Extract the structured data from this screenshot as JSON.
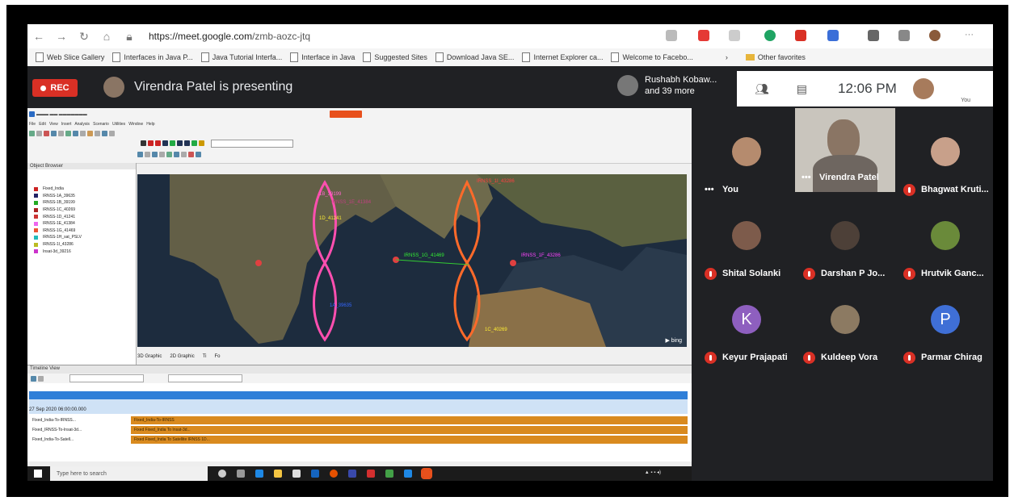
{
  "browser": {
    "url_host": "https://meet.google.com",
    "url_path": "/zmb-aozc-jtq",
    "favorites": [
      "Web Slice Gallery",
      "Interfaces in Java P...",
      "Java Tutorial Interfa...",
      "Interface in Java",
      "Suggested Sites",
      "Download Java SE...",
      "Internet Explorer ca...",
      "Welcome to Facebo..."
    ],
    "other_favorites": "Other favorites"
  },
  "meet": {
    "rec_label": "REC",
    "presenting_text": "Virendra Patel is presenting",
    "participants_name": "Rushabh Kobaw...",
    "participants_more": "and 39 more",
    "clock": "12:06 PM",
    "self_label": "You"
  },
  "stk": {
    "object_browser_title": "Object Browser",
    "tree_items": [
      "Fixed_India",
      "IRNSS-1A_39635",
      "IRNSS-1B_39199",
      "IRNSS-1C_40269",
      "IRNSS-1D_41241",
      "IRNSS-1E_41384",
      "IRNSS-1G_41469",
      "IRNSS-1H_sat_PSLV",
      "IRNSS-1I_43286",
      "Insat-3d_39216"
    ],
    "map_labels": [
      "1B_39199",
      "IRNSS_1I_43286",
      "IRNSS_1E_41384",
      "1D_41241",
      "IRNSS_1G_41469",
      "IRNSS_1F_43286",
      "1A_39635",
      "1C_40269"
    ],
    "map_tabs": [
      "3D Graphic",
      "2D Graphic",
      "Ti",
      "Fo"
    ],
    "timeline_title": "Timeline View",
    "timeline_date": "27 Sep 2020 06:00:00.000",
    "timeline_rows": [
      {
        "label": "Fixed_India-To-IRNSS...",
        "bar": "Fixed_India-To-IRNSS"
      },
      {
        "label": "Fixed_IRNSS-To-Insat-3d...",
        "bar": "Fixed Fixed_India To Insat-3d..."
      },
      {
        "label": "Fixed_India-To-Satell...",
        "bar": "Fixed Fixed_India To Satellite IRNSS 1D..."
      }
    ],
    "taskbar_search": "Type here to search"
  },
  "tiles": [
    {
      "name": "You",
      "more": "•••",
      "color": "#b58b6e",
      "muted": false,
      "initial": ""
    },
    {
      "name": "Virendra Patel",
      "more": "•••",
      "color": "#8a7564",
      "muted": false,
      "initial": ""
    },
    {
      "name": "Bhagwat Kruti...",
      "color": "#c8a08a",
      "muted": true,
      "initial": ""
    },
    {
      "name": "Shital Solanki",
      "color": "#7d5b4b",
      "muted": true,
      "initial": ""
    },
    {
      "name": "Darshan P Jo...",
      "color": "#4d4038",
      "muted": true,
      "initial": ""
    },
    {
      "name": "Hrutvik Ganc...",
      "color": "#6a8a3a",
      "muted": true,
      "initial": ""
    },
    {
      "name": "Keyur Prajapati",
      "color": "#8e5fbf",
      "muted": true,
      "initial": "K"
    },
    {
      "name": "Kuldeep Vora",
      "color": "#8c7a62",
      "muted": true,
      "initial": ""
    },
    {
      "name": "Parmar Chirag",
      "color": "#3f6fd6",
      "muted": true,
      "initial": "P"
    }
  ]
}
